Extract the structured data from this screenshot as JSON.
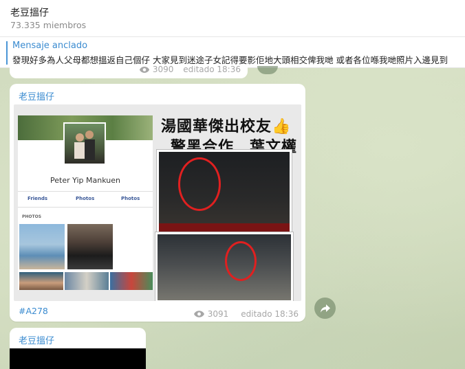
{
  "header": {
    "title": "老豆搵仔",
    "members": "73.335 miembros"
  },
  "pinned": {
    "label": "Mensaje anclado",
    "text": "發現好多為人父母都想搵返自己個仔 大家見到迷途子女記得要影佢地大頭相交俾我哋 或者各位喺我哋照片入邊見到"
  },
  "prev_message": {
    "views": "3090",
    "time": "editado 18:36"
  },
  "message": {
    "sender": "老豆搵仔",
    "image": {
      "profile_name": "Peter Yip Mankuen",
      "tabs": [
        "Friends",
        "Photos",
        "Photos"
      ],
      "photos_label": "PHOTOS",
      "headline_line1": "湯國華傑出校友👍",
      "headline_line2": "警黑合作　葉文權"
    },
    "hashtag": "#A278",
    "views": "3091",
    "time": "editado 18:36"
  },
  "next_message": {
    "sender": "老豆搵仔"
  },
  "colors": {
    "accent": "#3a8bd0",
    "meta": "#a7a7a7",
    "circle": "#e02020"
  }
}
